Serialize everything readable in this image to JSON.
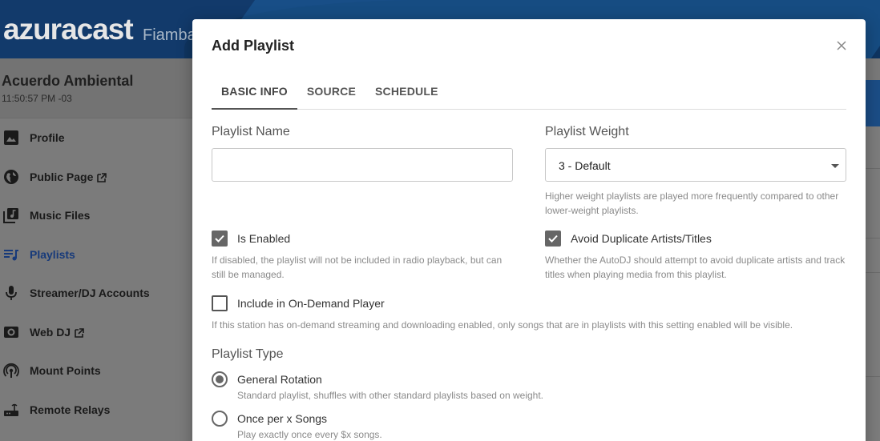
{
  "header": {
    "logo": "azuracast",
    "breadcrumb": "Fiamba"
  },
  "station": {
    "name": "Acuerdo Ambiental",
    "time": "11:50:57 PM -03"
  },
  "sidebar": {
    "items": [
      {
        "label": "Profile",
        "icon": "image-icon"
      },
      {
        "label": "Public Page",
        "icon": "globe-icon",
        "external": true
      },
      {
        "label": "Music Files",
        "icon": "music-library-icon"
      },
      {
        "label": "Playlists",
        "icon": "playlist-icon",
        "active": true
      },
      {
        "label": "Streamer/DJ Accounts",
        "icon": "microphone-icon"
      },
      {
        "label": "Web DJ",
        "icon": "speaker-icon",
        "external": true
      },
      {
        "label": "Mount Points",
        "icon": "podcast-icon"
      },
      {
        "label": "Remote Relays",
        "icon": "router-icon"
      }
    ]
  },
  "modal": {
    "title": "Add Playlist",
    "tabs": [
      {
        "label": "BASIC INFO",
        "active": true
      },
      {
        "label": "SOURCE"
      },
      {
        "label": "SCHEDULE"
      }
    ],
    "playlist_name": {
      "label": "Playlist Name",
      "value": ""
    },
    "playlist_weight": {
      "label": "Playlist Weight",
      "selected": "3 - Default",
      "help": "Higher weight playlists are played more frequently compared to other lower-weight playlists."
    },
    "is_enabled": {
      "label": "Is Enabled",
      "checked": true,
      "help": "If disabled, the playlist will not be included in radio playback, but can still be managed."
    },
    "avoid_duplicates": {
      "label": "Avoid Duplicate Artists/Titles",
      "checked": true,
      "help": "Whether the AutoDJ should attempt to avoid duplicate artists and track titles when playing media from this playlist."
    },
    "on_demand": {
      "label": "Include in On-Demand Player",
      "checked": false,
      "help": "If this station has on-demand streaming and downloading enabled, only songs that are in playlists with this setting enabled will be visible."
    },
    "playlist_type": {
      "label": "Playlist Type",
      "options": [
        {
          "label": "General Rotation",
          "description": "Standard playlist, shuffles with other standard playlists based on weight.",
          "selected": true
        },
        {
          "label": "Once per x Songs",
          "description": "Play exactly once every $x songs.",
          "selected": false
        }
      ]
    }
  },
  "colors": {
    "brand_blue": "#1d5e9e",
    "active_nav": "#173a7a",
    "checkbox": "#666666"
  }
}
